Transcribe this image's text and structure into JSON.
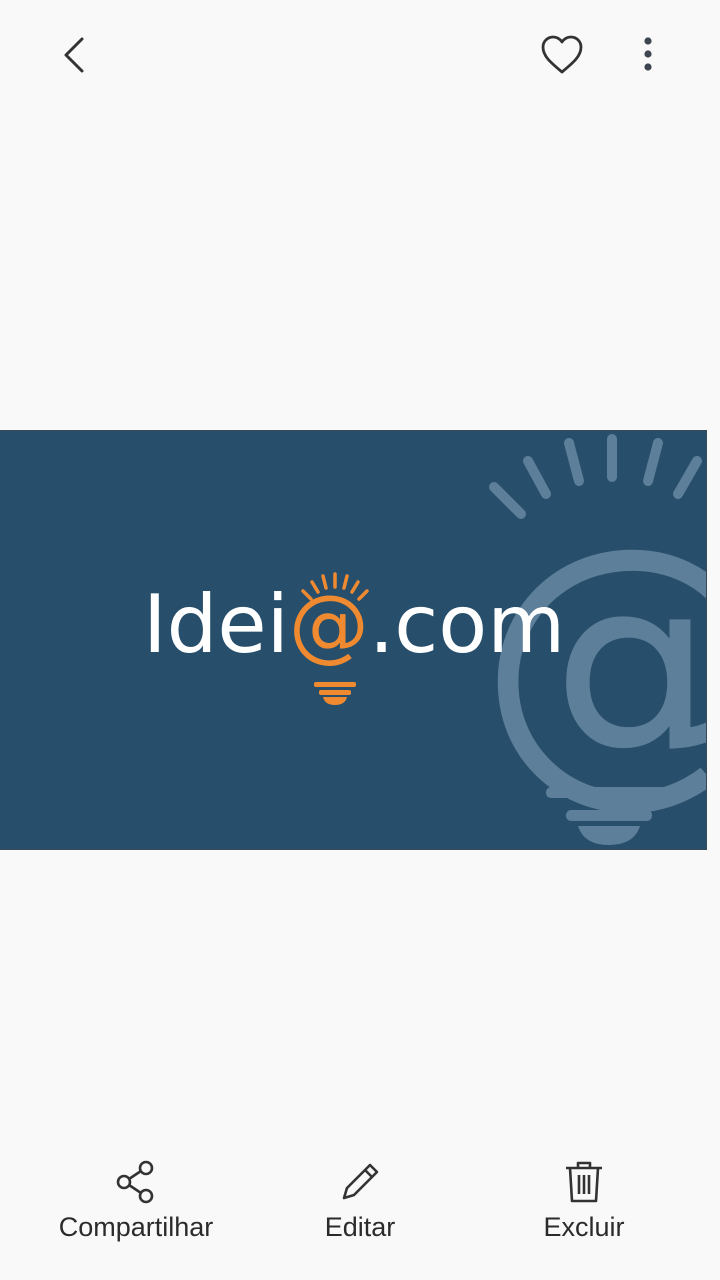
{
  "topbar": {
    "back_icon": "chevron-left-icon",
    "favorite_icon": "heart-outline-icon",
    "more_icon": "more-vertical-icon"
  },
  "image": {
    "background_color": "#274f6c",
    "logo": {
      "text_before": "Idei",
      "accent": "@",
      "text_after": ".com",
      "accent_color": "#f08a30",
      "watermark_icon": "lightbulb-at-icon"
    }
  },
  "actions": {
    "share": {
      "label": "Compartilhar",
      "icon": "share-icon"
    },
    "edit": {
      "label": "Editar",
      "icon": "pencil-icon"
    },
    "delete": {
      "label": "Excluir",
      "icon": "trash-icon"
    }
  }
}
